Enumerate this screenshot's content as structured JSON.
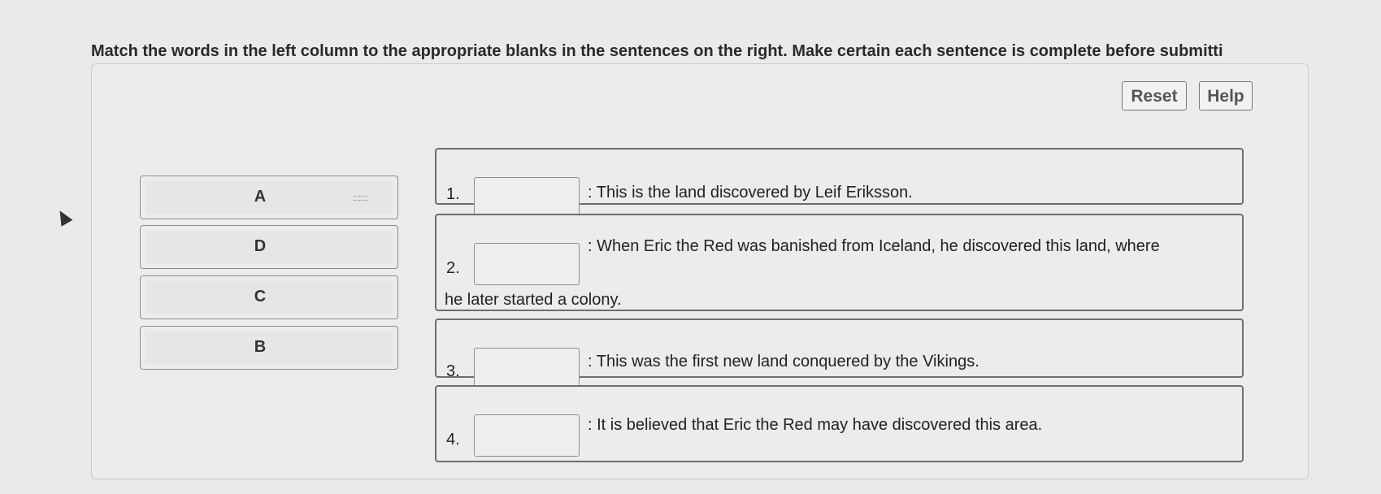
{
  "instructions": "Match the words in the left column to the appropriate blanks in the sentences on the right. Make certain each sentence is complete before submitti",
  "toolbar": {
    "reset_label": "Reset",
    "help_label": "Help"
  },
  "word_tiles": [
    {
      "label": "A"
    },
    {
      "label": "D"
    },
    {
      "label": "C"
    },
    {
      "label": "B"
    }
  ],
  "sentences": [
    {
      "number": "1.",
      "text": ": This is the land discovered by Leif Eriksson."
    },
    {
      "number": "2.",
      "text": ": When Eric the Red was banished from Iceland, he discovered this land, where",
      "text_continued": "he later started a colony."
    },
    {
      "number": "3.",
      "text": ": This was the first new land conquered by the Vikings."
    },
    {
      "number": "4.",
      "text": ": It is believed that Eric the Red may have discovered this area."
    }
  ]
}
